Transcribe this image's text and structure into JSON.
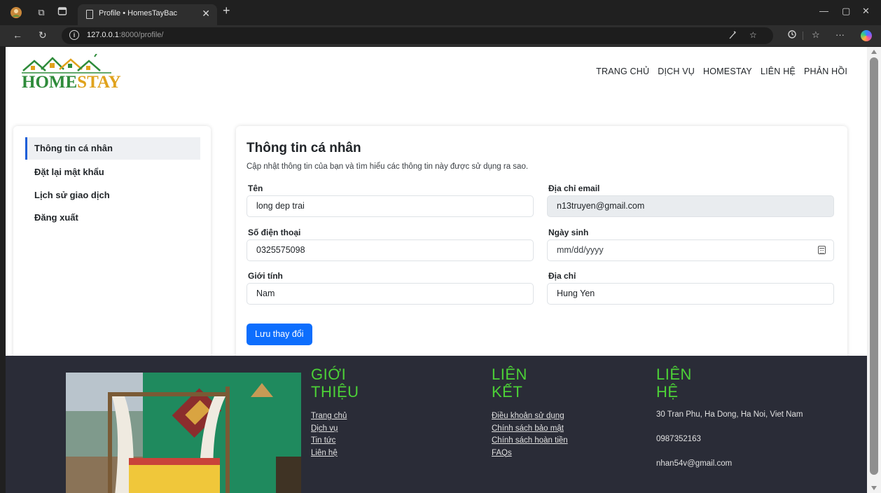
{
  "browser": {
    "tab_title": "Profile • HomesTayBac",
    "url_host": "127.0.0.1",
    "url_path": ":8000/profile/"
  },
  "site": {
    "logo_word_1": "HOME",
    "logo_word_2": "STAY",
    "nav": [
      "TRANG CHỦ",
      "DỊCH VỤ",
      "HOMESTAY",
      "LIÊN HỆ",
      "PHẢN HỒI"
    ]
  },
  "sidebar": {
    "items": [
      {
        "label": "Thông tin cá nhân",
        "active": true
      },
      {
        "label": "Đặt lại mật khẩu",
        "active": false
      },
      {
        "label": "Lịch sử giao dịch",
        "active": false
      },
      {
        "label": "Đăng xuất",
        "active": false
      }
    ]
  },
  "profile": {
    "title": "Thông tin cá nhân",
    "subtitle": "Cập nhật thông tin của bạn và tìm hiểu các thông tin này được sử dụng ra sao.",
    "name_label": "Tên",
    "name_value": "long dep trai",
    "email_label": "Địa chỉ email",
    "email_value": "n13truyen@gmail.com",
    "phone_label": "Số điện thoại",
    "phone_value": "0325575098",
    "birthday_label": "Ngày sinh",
    "birthday_value": "mm/dd/yyyy",
    "gender_label": "Giới tính",
    "gender_value": "Nam",
    "address_label": "Địa chỉ",
    "address_value": "Hung Yen",
    "save_label": "Lưu thay đổi"
  },
  "footer": {
    "about": {
      "title_1": "GIỚI",
      "title_2": "THIỆU",
      "links": [
        "Trang chủ",
        "Dịch vụ",
        "Tin tức",
        "Liên hệ"
      ]
    },
    "links": {
      "title_1": "LIÊN",
      "title_2": "KẾT",
      "links": [
        "Điều khoản sử dụng",
        "Chính sách bảo mật",
        "Chính sách hoàn tiền",
        "FAQs"
      ]
    },
    "contact": {
      "title_1": "LIÊN",
      "title_2": "HỆ",
      "address": "30 Tran Phu, Ha Dong, Ha Noi, Viet Nam",
      "phone": "0987352163",
      "email": "nhan54v@gmail.com"
    }
  },
  "colors": {
    "primary": "#0d6efd",
    "footer_bg": "#2a2c37",
    "footer_heading": "#4cd137",
    "logo_green": "#2e8b3a",
    "logo_gold": "#e0a21c"
  }
}
